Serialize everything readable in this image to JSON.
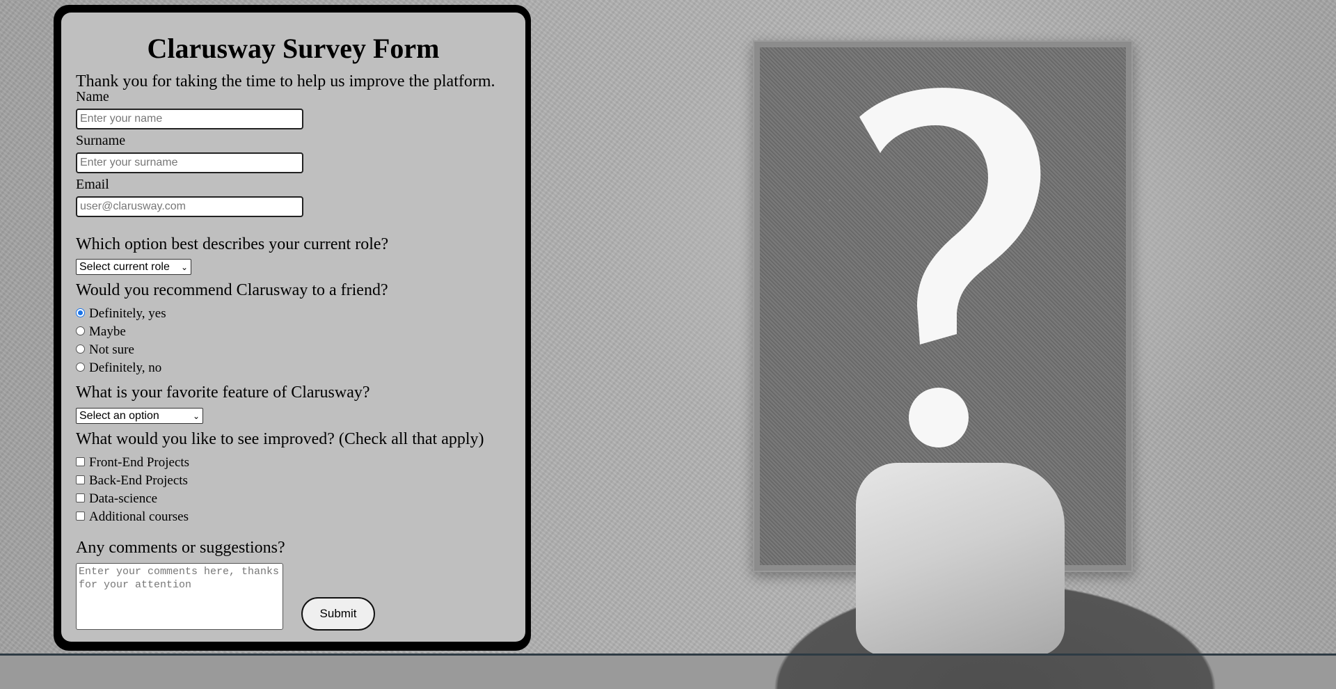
{
  "form": {
    "title": "Clarusway Survey Form",
    "intro": "Thank you for taking the time to help us improve the platform.",
    "name_label": "Name",
    "name_placeholder": "Enter your name",
    "surname_label": "Surname",
    "surname_placeholder": "Enter your surname",
    "email_label": "Email",
    "email_placeholder": "user@clarusway.com",
    "role_question": "Which option best describes your current role?",
    "role_select": "Select current role",
    "recommend_question": "Would you recommend Clarusway to a friend?",
    "recommend_options": [
      "Definitely, yes",
      "Maybe",
      "Not sure",
      "Definitely, no"
    ],
    "recommend_selected": "Definitely, yes",
    "feature_question": "What is your favorite feature of Clarusway?",
    "feature_select": "Select an option",
    "improve_question": "What would you like to see improved? (Check all that apply)",
    "improve_options": [
      "Front-End Projects",
      "Back-End Projects",
      "Data-science",
      "Additional courses"
    ],
    "comments_question": "Any comments or suggestions?",
    "comments_placeholder": "Enter your comments here, thanks for your attention",
    "submit_label": "Submit"
  },
  "icons": {
    "select_arrow": "chevron-down-icon",
    "background": "question-mark-icon"
  },
  "colors": {
    "form_background": "#bfbfbf",
    "panel_border": "#000000",
    "radio_accent": "#1a73e8"
  }
}
